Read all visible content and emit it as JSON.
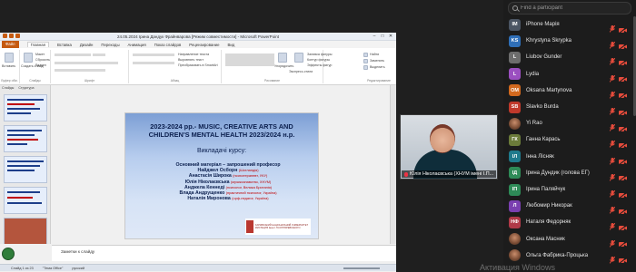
{
  "ppt": {
    "title": "24.05.2024 Ірина Дандук Фрайнварова [Режим совместимости] - Microsoft PowerPoint",
    "tabs": [
      "Файл",
      "Главная",
      "Вставка",
      "Дизайн",
      "Переходы",
      "Анимация",
      "Показ слайдов",
      "Рецензирование",
      "Вид"
    ],
    "ribbon": {
      "paste": "Вставить",
      "create": "Создать слайд",
      "groups": [
        "Буфер обм.",
        "Слайды",
        "Шрифт",
        "Абзац",
        "Рисование",
        "Редактирование"
      ],
      "dir_text": "Направление текста",
      "align_text": "Выровнять текст",
      "convert_smartart": "Преобразовать в SmartArt",
      "arrange": "Упорядочить",
      "quick_styles": "Экспресс-стили",
      "find": "Найти",
      "replace": "Заменить",
      "select": "Выделить",
      "fill": "Заливка фигуры",
      "outline": "Контур фигуры",
      "effects": "Эффекты фигур",
      "layout": "Макет",
      "reset": "Сбросить",
      "section": "Раздел"
    },
    "thumbs_tabs": [
      "Слайды",
      "Структура"
    ],
    "slide": {
      "title": "2023-2024 рр.- MUSIC, CREATIVE ARTS AND CHILDREN'S MENTAL HEALTH 2023/2024 н.р.",
      "subtitle": "Викладачі курсу:",
      "people": [
        {
          "name": "Основний матеріал – запрошений професор",
          "role": ""
        },
        {
          "name": "Найджел Осборн",
          "role": "(Шотландія)"
        },
        {
          "name": "Анастасія Широка",
          "role": "(психотерапевт, УКУ)"
        },
        {
          "name": "Юлія Ніколаєвська",
          "role": "(музикознавство, ХНУМ)"
        },
        {
          "name": "Анджела Кеннеді",
          "role": "(психолог, Велика Британія)"
        },
        {
          "name": "Влада Андрущенко",
          "role": "(практичний психолог, Україна)"
        },
        {
          "name": "Наталія Миронова",
          "role": "(орф-педагог, Україна)"
        }
      ],
      "logo_text": "ХАРКІВСЬКИЙ НАЦІОНАЛЬНИЙ УНІВЕРСИТЕТ МИСТЕЦТВ імені І.П.КОТЛЯРЕВСЬКОГО"
    },
    "notes": "Заметки к слайду",
    "status": [
      "Слайд 1 из 23",
      "\"Тема Office\"",
      "русский"
    ]
  },
  "speaker": {
    "name": "Юлія Ніколаєвська (ХНУМ імені І.П..."
  },
  "panel": {
    "search_placeholder": "Find a participant",
    "participants": [
      {
        "initials": "IM",
        "color": "#4b5563",
        "name": "iPhone Марія"
      },
      {
        "initials": "KS",
        "color": "#2f6fb8",
        "name": "Khrystyna Skrypka"
      },
      {
        "initials": "L",
        "color": "#6d6d6d",
        "name": "Liubov Gunder"
      },
      {
        "initials": "L",
        "color": "#9b4fc0",
        "name": "Lydia"
      },
      {
        "initials": "OM",
        "color": "#d2691e",
        "name": "Oksana Martynova"
      },
      {
        "initials": "SB",
        "color": "#c0392b",
        "name": "Slavko Burda"
      },
      {
        "initials": "",
        "color": "",
        "name": "Yi Rao",
        "photo": true
      },
      {
        "initials": "ГК",
        "color": "#6b7b3a",
        "name": "Ганна Карась"
      },
      {
        "initials": "ІЛ",
        "color": "#1f7a8c",
        "name": "Інна Лісняк"
      },
      {
        "initials": "ІД",
        "color": "#2e8b57",
        "name": "Ірина Дундик (голова ЕГ)"
      },
      {
        "initials": "ІП",
        "color": "#2e8b57",
        "name": "Ірина Паляйчук"
      },
      {
        "initials": "Л",
        "color": "#7a3fb0",
        "name": "Любомир Никорак"
      },
      {
        "initials": "НФ",
        "color": "#b03a48",
        "name": "Наталя Федорняк"
      },
      {
        "initials": "",
        "color": "",
        "name": "Оксана Масник",
        "photo": true
      },
      {
        "initials": "",
        "color": "",
        "name": "Ольга Фабрика-Процька",
        "photo": true
      }
    ]
  },
  "watermark": "Активация Windows"
}
